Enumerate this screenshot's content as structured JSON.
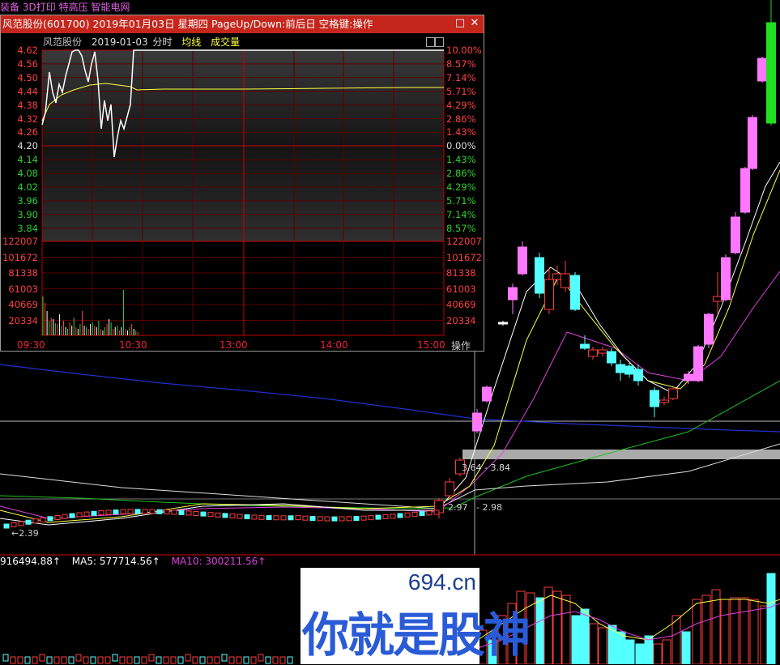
{
  "top_tags": [
    "装备",
    "3D打印",
    "特高压",
    "智能电网"
  ],
  "volume_legend": [
    {
      "text": "916494.88↑",
      "color": "#ffffff"
    },
    {
      "text": "MA5: 577714.56↑",
      "color": "#ffffff"
    },
    {
      "text": "MA10: 300211.56↑",
      "color": "#e040e0"
    }
  ],
  "price_notes": {
    "low": "2.39",
    "mid_low": "2.97",
    "mid_right": "2.98",
    "cross": "3.64",
    "cross2": "3.84"
  },
  "popup": {
    "title": "风范股份(601700) 2019年01月03日 星期四 PageUp/Down:前后日 空格键:操作",
    "stock_name": "风范股份",
    "date": "2019-01-03",
    "mode": "分时",
    "avg_label": "均线",
    "vol_label": "成交量",
    "price_ticks": [
      "4.62",
      "4.56",
      "4.50",
      "4.44",
      "4.38",
      "4.32",
      "4.26",
      "4.20",
      "4.14",
      "4.08",
      "4.02",
      "3.96",
      "3.90",
      "3.84"
    ],
    "pct_ticks": [
      "10.00%",
      "8.57%",
      "7.14%",
      "5.71%",
      "4.29%",
      "2.86%",
      "1.43%",
      "0.00%",
      "1.43%",
      "2.86%",
      "4.29%",
      "5.71%",
      "7.14%",
      "8.57%"
    ],
    "vol_ticks": [
      "122007",
      "101672",
      "81338",
      "61003",
      "40669",
      "20334"
    ],
    "time_ticks": [
      "09:30",
      "10:30",
      "13:00",
      "14:00",
      "15:00"
    ],
    "op_label": "操作"
  },
  "watermark": {
    "url": "694.cn",
    "text": "你就是股神"
  },
  "colors": {
    "up": "#ff3c3c",
    "down": "#54ffff",
    "ma_white": "#ffffff",
    "ma_yellow": "#ffff40",
    "ma_magenta": "#e040e0",
    "ma_green": "#20c020",
    "ma_blue": "#2030d0"
  }
}
